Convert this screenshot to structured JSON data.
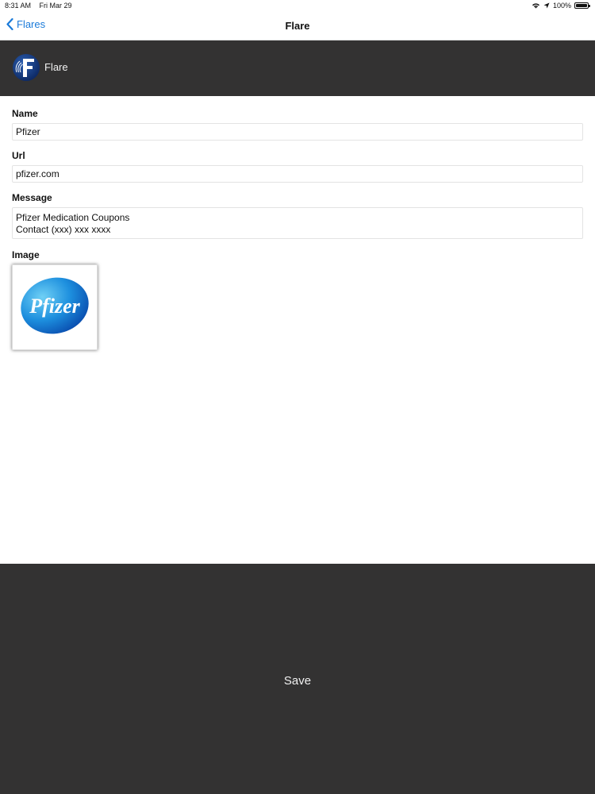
{
  "status_bar": {
    "time": "8:31 AM",
    "date": "Fri Mar 29",
    "battery": "100%"
  },
  "nav": {
    "back_label": "Flares",
    "title": "Flare"
  },
  "app_header": {
    "name": "Flare",
    "background_color": "#333232"
  },
  "form": {
    "name_label": "Name",
    "name_value": "Pfizer",
    "url_label": "Url",
    "url_value": "pfizer.com",
    "message_label": "Message",
    "message_lines": [
      "Pfizer Medication Coupons",
      "Contact (xxx) xxx xxxx"
    ],
    "image_label": "Image",
    "image_logo_text": "Pfizer"
  },
  "save_label": "Save",
  "colors": {
    "accent": "#1a7ad9",
    "dark_panel": "#333232"
  }
}
